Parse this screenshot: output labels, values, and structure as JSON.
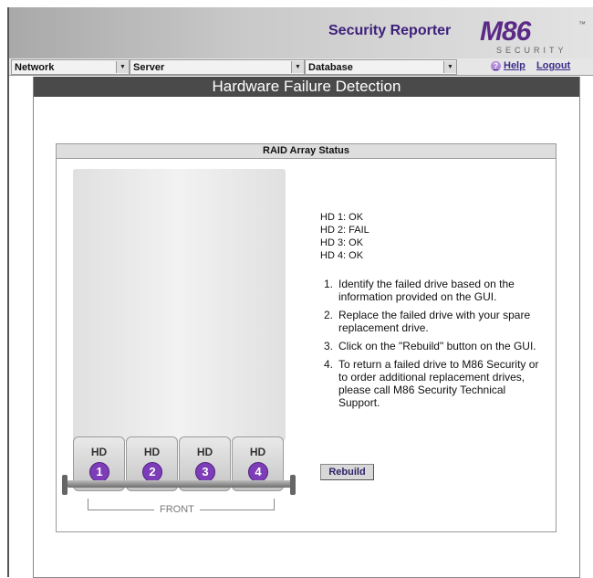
{
  "header": {
    "app_title": "Security Reporter",
    "logo": {
      "main": "M86",
      "sub": "SECURITY",
      "tm": "™"
    }
  },
  "nav": {
    "menus": [
      {
        "label": "Network"
      },
      {
        "label": "Server"
      },
      {
        "label": "Database"
      }
    ],
    "help": "Help",
    "logout": "Logout"
  },
  "panel": {
    "title": "Hardware Failure Detection"
  },
  "raid": {
    "header": "RAID Array Status",
    "drives": [
      {
        "label": "HD",
        "number": "1"
      },
      {
        "label": "HD",
        "number": "2"
      },
      {
        "label": "HD",
        "number": "3"
      },
      {
        "label": "HD",
        "number": "4"
      }
    ],
    "front_label": "FRONT",
    "status": [
      "HD 1: OK",
      "HD 2: FAIL",
      "HD 3: OK",
      "HD 4: OK"
    ],
    "steps": [
      {
        "n": "1.",
        "text": "Identify the failed drive based on the information provided on the GUI."
      },
      {
        "n": "2.",
        "text": "Replace the failed drive with your spare replacement drive."
      },
      {
        "n": "3.",
        "text": "Click on the \"Rebuild\" button on the GUI."
      },
      {
        "n": "4.",
        "text": "To return a failed drive to M86 Security or to order additional replacement drives, please call M86 Security Technical Support."
      }
    ],
    "rebuild_label": "Rebuild"
  }
}
